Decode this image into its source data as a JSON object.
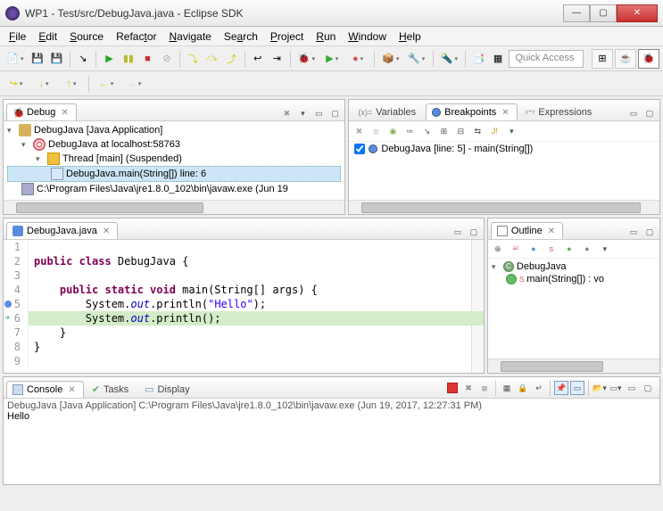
{
  "window": {
    "title": "WP1 - Test/src/DebugJava.java - Eclipse SDK",
    "min": "—",
    "max": "▢",
    "close": "✕"
  },
  "menus": [
    "File",
    "Edit",
    "Source",
    "Refactor",
    "Navigate",
    "Search",
    "Project",
    "Run",
    "Window",
    "Help"
  ],
  "quick_access": "Quick Access",
  "debug": {
    "tab": "Debug",
    "app": "DebugJava [Java Application]",
    "target": "DebugJava at localhost:58763",
    "thread": "Thread [main] (Suspended)",
    "frame": "DebugJava.main(String[]) line: 6",
    "exe": "C:\\Program Files\\Java\\jre1.8.0_102\\bin\\javaw.exe (Jun 19"
  },
  "vars_tab": "Variables",
  "bp_tab": "Breakpoints",
  "expr_tab": "Expressions",
  "breakpoint": "DebugJava [line: 5] - main(String[])",
  "editor": {
    "tab": "DebugJava.java",
    "lines": {
      "l1": "",
      "l2_pre": "public class ",
      "l2_name": "DebugJava {",
      "l3": "",
      "l4_pre": "    public static void ",
      "l4_sig": "main(String[] args) {",
      "l5_a": "        System.",
      "l5_out": "out",
      "l5_b": ".println(",
      "l5_str": "\"Hello\"",
      "l5_c": ");",
      "l6_a": "        System.",
      "l6_out": "out",
      "l6_b": ".println();",
      "l7": "    }",
      "l8": "}",
      "l9": ""
    },
    "nums": [
      "1",
      "2",
      "3",
      "4",
      "5",
      "6",
      "7",
      "8",
      "9"
    ]
  },
  "outline": {
    "tab": "Outline",
    "class": "DebugJava",
    "method": "main(String[]) : vo"
  },
  "console": {
    "tab_console": "Console",
    "tab_tasks": "Tasks",
    "tab_display": "Display",
    "header": "DebugJava [Java Application] C:\\Program Files\\Java\\jre1.8.0_102\\bin\\javaw.exe (Jun 19, 2017, 12:27:31 PM)",
    "output": "Hello"
  }
}
